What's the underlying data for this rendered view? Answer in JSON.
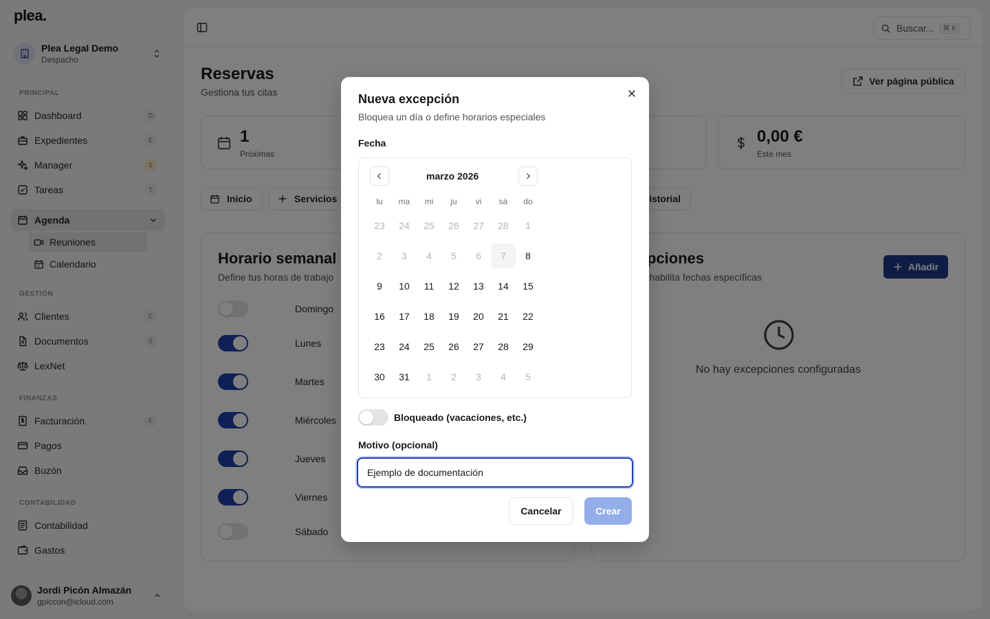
{
  "sidebar": {
    "logo": "plea.",
    "org": {
      "name": "Plea Legal Demo",
      "sub": "Despacho"
    },
    "sections": {
      "principal": "PRINCIPAL",
      "gestion": "GESTIÓN",
      "finanzas": "FINANZAS",
      "contabilidad": "CONTABILIDAD"
    },
    "items": {
      "dashboard": {
        "label": "Dashboard",
        "kbd": "D"
      },
      "expedientes": {
        "label": "Expedientes",
        "kbd": "E"
      },
      "manager": {
        "label": "Manager",
        "kbd": "1"
      },
      "tareas": {
        "label": "Tareas",
        "kbd": "T"
      },
      "agenda": {
        "label": "Agenda"
      },
      "reuniones": {
        "label": "Reuniones"
      },
      "calendario": {
        "label": "Calendario"
      },
      "clientes": {
        "label": "Clientes",
        "kbd": "C"
      },
      "documentos": {
        "label": "Documentos",
        "kbd": "0"
      },
      "lexnet": {
        "label": "LexNet"
      },
      "facturacion": {
        "label": "Facturación",
        "kbd": "F"
      },
      "pagos": {
        "label": "Pagos"
      },
      "buzon": {
        "label": "Buzón"
      },
      "contabilidad": {
        "label": "Contabilidad"
      },
      "gastos": {
        "label": "Gastos"
      }
    },
    "user": {
      "name": "Jordi Picón Almazán",
      "email": "gpiccon@icloud.com"
    }
  },
  "topbar": {
    "search_placeholder": "Buscar...",
    "search_kbd": "⌘ K"
  },
  "page": {
    "title": "Reservas",
    "subtitle": "Gestiona tus citas",
    "public_button": "Ver página pública",
    "stats": [
      {
        "value": "1",
        "caption": "Próximas"
      },
      {
        "value": "0,00 €",
        "caption": "Este mes"
      }
    ],
    "tabs": {
      "inicio": "Inicio",
      "servicios": "Servicios",
      "historial": "istorial"
    },
    "weekly": {
      "title": "Horario semanal",
      "subtitle": "Define tus horas de trabajo",
      "days": [
        {
          "label": "Domingo",
          "on": false
        },
        {
          "label": "Lunes",
          "on": true
        },
        {
          "label": "Martes",
          "on": true
        },
        {
          "label": "Miércoles",
          "on": true
        },
        {
          "label": "Jueves",
          "on": true
        },
        {
          "label": "Viernes",
          "on": true
        },
        {
          "label": "Sábado",
          "on": false
        }
      ]
    },
    "exceptions": {
      "title": "pciones",
      "subtitle": "o habilita fechas específicas",
      "add_button": "Añadir",
      "empty": "No hay excepciones configuradas"
    }
  },
  "modal": {
    "title": "Nueva excepción",
    "description": "Bloquea un día o define horarios especiales",
    "date_label": "Fecha",
    "calendar": {
      "month": "marzo 2026",
      "weekdays": [
        "lu",
        "ma",
        "mi",
        "ju",
        "vi",
        "sá",
        "do"
      ],
      "weeks": [
        [
          [
            "23",
            "out"
          ],
          [
            "24",
            "out"
          ],
          [
            "25",
            "out"
          ],
          [
            "26",
            "out"
          ],
          [
            "27",
            "out"
          ],
          [
            "28",
            "out"
          ],
          [
            "1",
            "dis"
          ]
        ],
        [
          [
            "2",
            "dis"
          ],
          [
            "3",
            "dis"
          ],
          [
            "4",
            "dis"
          ],
          [
            "5",
            "dis"
          ],
          [
            "6",
            "dis"
          ],
          [
            "7",
            "today"
          ],
          [
            "8",
            "norm"
          ]
        ],
        [
          [
            "9",
            "norm"
          ],
          [
            "10",
            "norm"
          ],
          [
            "11",
            "norm"
          ],
          [
            "12",
            "norm"
          ],
          [
            "13",
            "norm"
          ],
          [
            "14",
            "norm"
          ],
          [
            "15",
            "norm"
          ]
        ],
        [
          [
            "16",
            "norm"
          ],
          [
            "17",
            "norm"
          ],
          [
            "18",
            "norm"
          ],
          [
            "19",
            "norm"
          ],
          [
            "20",
            "norm"
          ],
          [
            "21",
            "norm"
          ],
          [
            "22",
            "norm"
          ]
        ],
        [
          [
            "23",
            "norm"
          ],
          [
            "24",
            "norm"
          ],
          [
            "25",
            "norm"
          ],
          [
            "26",
            "norm"
          ],
          [
            "27",
            "norm"
          ],
          [
            "28",
            "norm"
          ],
          [
            "29",
            "norm"
          ]
        ],
        [
          [
            "30",
            "norm"
          ],
          [
            "31",
            "norm"
          ],
          [
            "1",
            "out"
          ],
          [
            "2",
            "out"
          ],
          [
            "3",
            "out"
          ],
          [
            "4",
            "out"
          ],
          [
            "5",
            "out"
          ]
        ]
      ]
    },
    "blocked_label": "Bloqueado (vacaciones, etc.)",
    "blocked_on": false,
    "reason_label": "Motivo (opcional)",
    "reason_value": "Ejemplo de documentación",
    "cancel": "Cancelar",
    "create": "Crear"
  },
  "colors": {
    "accent": "#1e40af",
    "create_disabled": "#93aee8",
    "overlay": "rgba(0,0,0,0.5)"
  }
}
